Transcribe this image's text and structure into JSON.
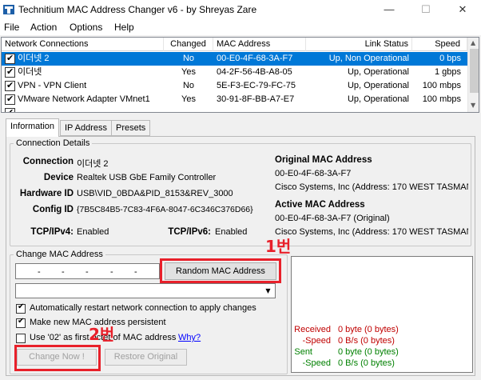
{
  "window": {
    "title": "Technitium MAC Address Changer v6 - by Shreyas Zare",
    "minimize": "—",
    "maximize": "☐",
    "close": "✕"
  },
  "menu": [
    "File",
    "Action",
    "Options",
    "Help"
  ],
  "list": {
    "columns": [
      "Network Connections",
      "Changed",
      "MAC Address",
      "Link Status",
      "Speed"
    ],
    "rows": [
      {
        "checked": true,
        "name": "이더넷 2",
        "changed": "No",
        "mac": "00-E0-4F-68-3A-F7",
        "status": "Up, Non Operational",
        "speed": "0 bps",
        "selected": true
      },
      {
        "checked": true,
        "name": "이더넷",
        "changed": "Yes",
        "mac": "04-2F-56-4B-A8-05",
        "status": "Up, Operational",
        "speed": "1 gbps",
        "selected": false
      },
      {
        "checked": true,
        "name": "VPN - VPN Client",
        "changed": "No",
        "mac": "5E-F3-EC-79-FC-75",
        "status": "Up, Operational",
        "speed": "100 mbps",
        "selected": false
      },
      {
        "checked": true,
        "name": "VMware Network Adapter VMnet1",
        "changed": "Yes",
        "mac": "30-91-8F-BB-A7-E7",
        "status": "Up, Operational",
        "speed": "100 mbps",
        "selected": false
      }
    ],
    "scroll_up": "▲",
    "scroll_down": "▼"
  },
  "tabs": [
    "Information",
    "IP Address",
    "Presets"
  ],
  "details": {
    "group_title": "Connection Details",
    "connection_label": "Connection",
    "connection_value": "이더넷 2",
    "device_label": "Device",
    "device_value": "Realtek USB GbE Family Controller",
    "hwid_label": "Hardware ID",
    "hwid_value": "USB\\VID_0BDA&PID_8153&REV_3000",
    "config_label": "Config ID",
    "config_value": "{7B5C84B5-7C83-4F6A-8047-6C346C376D66}",
    "tcp4_label": "TCP/IPv4:",
    "tcp4_value": "Enabled",
    "tcp6_label": "TCP/IPv6:",
    "tcp6_value": "Enabled",
    "orig_mac_title": "Original MAC Address",
    "orig_mac": "00-E0-4F-68-3A-F7",
    "orig_vendor": "Cisco Systems, Inc  (Address: 170 WEST TASMAN",
    "active_mac_title": "Active MAC Address",
    "active_mac": "00-E0-4F-68-3A-F7 (Original)",
    "active_vendor": "Cisco Systems, Inc  (Address: 170 WEST TASMAN"
  },
  "change": {
    "group_title": "Change MAC Address",
    "random_button": "Random MAC Address",
    "dash": "-",
    "dropdown_arrow": "▼",
    "opt_restart": "Automatically restart network connection to apply changes",
    "opt_persistent": "Make new MAC address persistent",
    "opt_02": "Use '02' as first octet of MAC address",
    "why_link": "Why?",
    "change_now": "Change Now !",
    "restore": "Restore Original"
  },
  "stats": {
    "received_label": "Received",
    "received_value": "0 byte (0 bytes)",
    "rx_speed_label": "-Speed",
    "rx_speed_value": "0 B/s (0 bytes)",
    "sent_label": "Sent",
    "sent_value": "0 byte (0 bytes)",
    "tx_speed_label": "-Speed",
    "tx_speed_value": "0 B/s (0 bytes)"
  },
  "annotations": {
    "one": "1번",
    "two": "2번"
  },
  "colors": {
    "selection": "#0078d7",
    "annotation": "#e8202a",
    "received": "#c00000",
    "sent": "#008000",
    "link": "#0000ff"
  }
}
